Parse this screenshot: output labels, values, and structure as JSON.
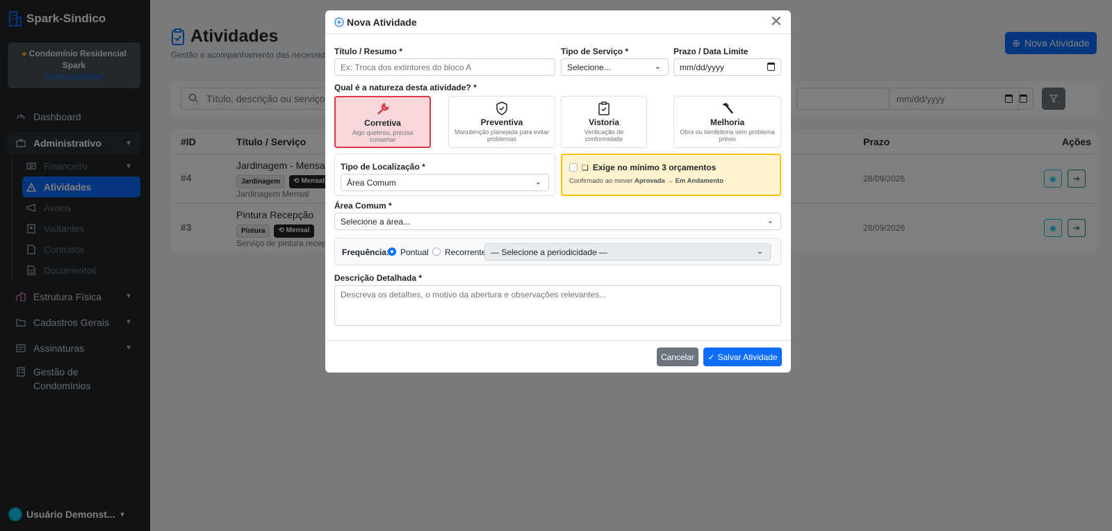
{
  "sidebar": {
    "brand": "Spark-Síndico",
    "condo_name": "Condomínio Residencial Spark",
    "condo_switch": "Trocar condomínio",
    "items": {
      "dashboard": "Dashboard",
      "administrativo": "Administrativo",
      "financeiro": "Financeiro",
      "atividades": "Atividades",
      "avisos": "Avisos",
      "visitantes": "Visitantes",
      "contratos": "Contratos",
      "documentos": "Documentos",
      "estrutura": "Estrutura Física",
      "cadastros": "Cadastros Gerais",
      "assinaturas": "Assinaturas",
      "gestao": "Gestão de Condomínios"
    },
    "user": "Usuário Demonst..."
  },
  "page": {
    "title": "Atividades",
    "subtitle": "Gestão e acompanhamento das necessidad",
    "new_button": "Nova Atividade",
    "search_placeholder": "Título, descrição ou serviço...",
    "date_placeholder": "mm/dd/yyyy"
  },
  "table": {
    "headers": {
      "id": "#ID",
      "title": "Título / Serviço",
      "deadline": "Prazo",
      "actions": "Ações"
    },
    "rows": [
      {
        "id": "#4",
        "title": "Jardinagem - Mensal",
        "badge1": "Jardinagem",
        "badge2": "Mensal",
        "desc": "Jardinagem Mensal",
        "deadline": "28/09/2026"
      },
      {
        "id": "#3",
        "title": "Pintura Recepção",
        "badge1": "Pintura",
        "badge2": "Mensal",
        "desc": "Serviço de pintura recepç",
        "deadline": "28/09/2026"
      }
    ]
  },
  "modal": {
    "title": "Nova Atividade",
    "titulo_label": "Título / Resumo *",
    "titulo_placeholder": "Ex: Troca dos extintores do bloco A",
    "tipo_label": "Tipo de Serviço *",
    "tipo_value": "Selecione...",
    "prazo_label": "Prazo / Data Limite",
    "prazo_placeholder": "mm/dd/yyyy",
    "natureza_label": "Qual é a natureza desta atividade? *",
    "types": [
      {
        "name": "Corretiva",
        "desc": "Algo quebrou, precisa consertar"
      },
      {
        "name": "Preventiva",
        "desc": "Manutenção planejada para evitar problemas"
      },
      {
        "name": "Vistoria",
        "desc": "Verificação de conformidade"
      },
      {
        "name": "Melhoria",
        "desc": "Obra ou benfeitoria sem problema prévio"
      }
    ],
    "loc_label": "Tipo de Localização *",
    "loc_value": "Área Comum",
    "quote_label": "Exige no mínimo 3 orçamentos",
    "quote_note_prefix": "Confirmado ao mover ",
    "quote_note_bold": "Aprovada → Em Andamento",
    "area_label": "Área Comum *",
    "area_value": "Selecione a área...",
    "freq_label": "Frequência:",
    "freq_opt1": "Pontual",
    "freq_opt2": "Recorrente",
    "freq_select": "— Selecione a periodicidade —",
    "desc_label": "Descrição Detalhada *",
    "desc_placeholder": "Descreva os detalhes, o motivo da abertura e observações relevantes...",
    "cancel": "Cancelar",
    "save": "Salvar Atividade"
  }
}
